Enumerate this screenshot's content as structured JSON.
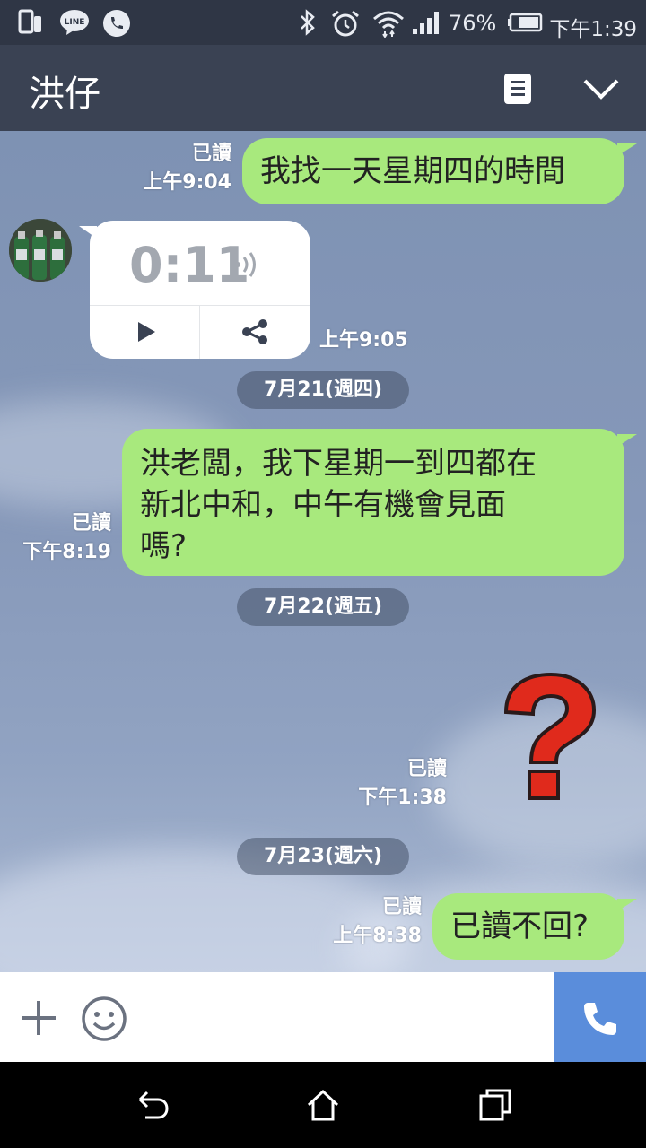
{
  "status_bar": {
    "battery": "76%",
    "time": "下午1:39",
    "icons": [
      "tablet-icon",
      "line-app-icon",
      "phone-call-icon",
      "bluetooth-icon",
      "alarm-icon",
      "wifi-icon",
      "signal-icon",
      "battery-icon"
    ]
  },
  "header": {
    "title": "洪仔",
    "note_icon": "note-icon",
    "expand_icon": "chevron-down-icon"
  },
  "messages": {
    "m1": {
      "text": "我找一天星期四的時間",
      "read": "已讀",
      "time": "上午9:04"
    },
    "voice": {
      "duration": "0:11",
      "time": "上午9:05"
    },
    "date1": "7月21(週四)",
    "m2": {
      "lines": [
        "洪老闆，我下星期一到四都在",
        "新北中和，中午有機會見面",
        "嗎?"
      ],
      "read": "已讀",
      "time": "下午8:19"
    },
    "date2": "7月22(週五)",
    "m3": {
      "read": "已讀",
      "time": "下午1:38"
    },
    "date3": "7月23(週六)",
    "m4": {
      "text": "已讀不回?",
      "read": "已讀",
      "time": "上午8:38"
    }
  },
  "input_bar": {
    "icons": [
      "plus-icon",
      "emoji-icon",
      "phone-icon"
    ]
  },
  "colors": {
    "header": "#3a4253",
    "bubble": "#a8e97d",
    "call_button": "#5a8ddb",
    "question_mark": "#e02a1c"
  }
}
